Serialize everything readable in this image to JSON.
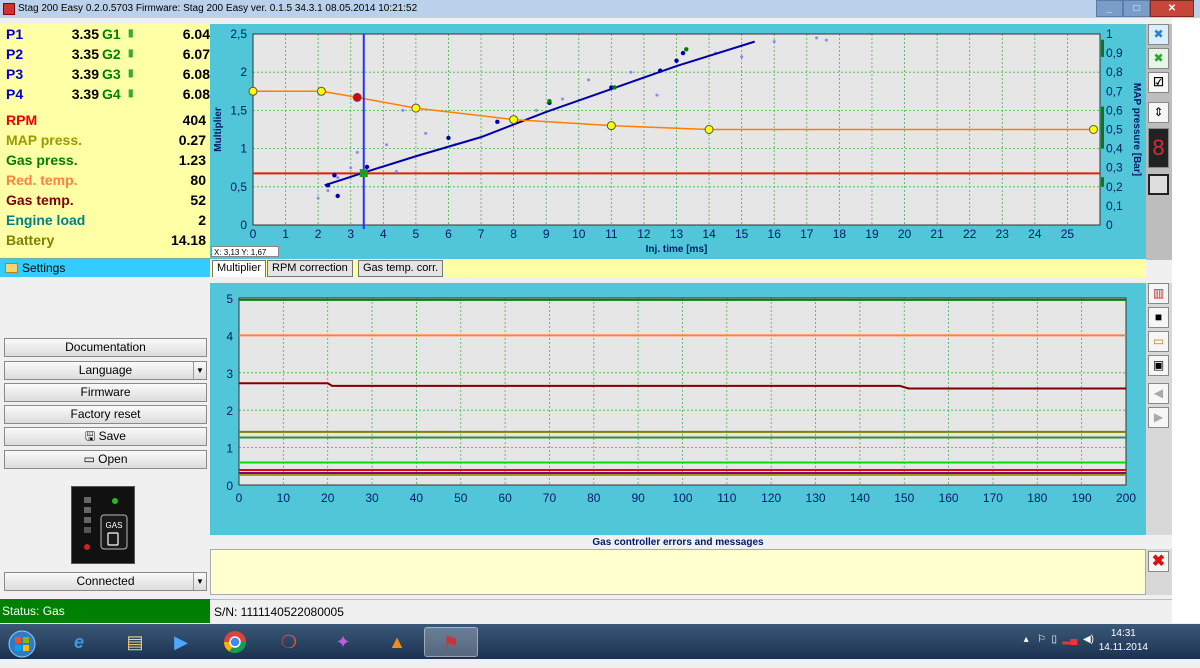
{
  "window": {
    "title": "Stag 200 Easy 0.2.0.5703 Firmware: Stag 200 Easy  ver. 0.1.5  34.3.1   08.05.2014 10:21:52"
  },
  "injectors": [
    {
      "p_label": "P1",
      "p_value": "3.35",
      "g_label": "G1",
      "g_value": "6.04"
    },
    {
      "p_label": "P2",
      "p_value": "3.35",
      "g_label": "G2",
      "g_value": "6.07"
    },
    {
      "p_label": "P3",
      "p_value": "3.39",
      "g_label": "G3",
      "g_value": "6.08"
    },
    {
      "p_label": "P4",
      "p_value": "3.39",
      "g_label": "G4",
      "g_value": "6.08"
    }
  ],
  "sensors": [
    {
      "label": "RPM",
      "value": "404",
      "color": "#ee0000"
    },
    {
      "label": "MAP press.",
      "value": "0.27",
      "color": "#999900"
    },
    {
      "label": "Gas press.",
      "value": "1.23",
      "color": "#008000"
    },
    {
      "label": "Red. temp.",
      "value": "80",
      "color": "#ff8040"
    },
    {
      "label": "Gas temp.",
      "value": "52",
      "color": "#800000"
    },
    {
      "label": "Engine load",
      "value": "2",
      "color": "#008080"
    },
    {
      "label": "Battery",
      "value": "14.18",
      "color": "#808000"
    }
  ],
  "settings_label": "Settings",
  "buttons": {
    "documentation": "Documentation",
    "language": "Language",
    "firmware": "Firmware",
    "factory_reset": "Factory reset",
    "save": "Save",
    "open": "Open",
    "connected": "Connected"
  },
  "gas_switch_label": "GAS",
  "status": "Status: Gas",
  "serial": "S/N: 1111140522080005",
  "coord_readout": "X: 3,13  Y: 1,67",
  "tabs": [
    "Multiplier",
    "RPM correction",
    "Gas temp. corr."
  ],
  "messages_title": "Gas controller errors and messages",
  "clock": {
    "time": "14:31",
    "date": "14.11.2014"
  },
  "chart_data": [
    {
      "type": "line",
      "xlabel": "Inj. time [ms]",
      "ylabel": "Multiplier",
      "y2label": "MAP pressure [Bar]",
      "xlim": [
        0,
        26
      ],
      "ylim": [
        0,
        2.5
      ],
      "y2lim": [
        0,
        1.0
      ],
      "xticks": [
        0,
        1,
        2,
        3,
        4,
        5,
        6,
        7,
        8,
        9,
        10,
        11,
        12,
        13,
        14,
        15,
        16,
        17,
        18,
        19,
        20,
        21,
        22,
        23,
        24,
        25
      ],
      "yticks": [
        "0",
        "0,5",
        "1",
        "1,5",
        "2",
        "2,5"
      ],
      "y2ticks": [
        "0",
        "0,1",
        "0,2",
        "0,3",
        "0,4",
        "0,5",
        "0,6",
        "0,7",
        "0,8",
        "0,9",
        "1"
      ],
      "cursor_x": 3.4,
      "map_level": 0.27,
      "series": [
        {
          "color": "#ff8000",
          "x": [
            0,
            2.1,
            3.2,
            5.0,
            8.0,
            11.0,
            14.0,
            25.8
          ],
          "y": [
            1.75,
            1.75,
            1.67,
            1.53,
            1.38,
            1.3,
            1.25,
            1.25
          ]
        },
        {
          "color": "#0000aa",
          "x": [
            2.2,
            3.5,
            5.0,
            7.0,
            9.0,
            11.0,
            13.0,
            15.4
          ],
          "y": [
            0.52,
            0.7,
            0.9,
            1.15,
            1.48,
            1.78,
            2.08,
            2.4
          ]
        }
      ]
    },
    {
      "type": "line",
      "xlim": [
        0,
        200
      ],
      "ylim": [
        0,
        5
      ],
      "xticks": [
        0,
        10,
        20,
        30,
        40,
        50,
        60,
        70,
        80,
        90,
        100,
        110,
        120,
        130,
        140,
        150,
        160,
        170,
        180,
        190,
        200
      ],
      "yticks": [
        0,
        1,
        2,
        3,
        4,
        5
      ],
      "series": [
        {
          "color": "#008000",
          "x": [
            0,
            200
          ],
          "y": [
            4.95,
            4.95
          ]
        },
        {
          "color": "#ff8040",
          "x": [
            0,
            200
          ],
          "y": [
            4.0,
            4.0
          ]
        },
        {
          "color": "#800000",
          "x": [
            0,
            20,
            21,
            149,
            151,
            200
          ],
          "y": [
            2.72,
            2.72,
            2.65,
            2.65,
            2.58,
            2.58
          ]
        },
        {
          "color": "#808000",
          "x": [
            0,
            200
          ],
          "y": [
            1.42,
            1.42
          ]
        },
        {
          "color": "#3a8a3a",
          "x": [
            0,
            200
          ],
          "y": [
            1.27,
            1.27
          ]
        },
        {
          "color": "#00dd00",
          "x": [
            0,
            200
          ],
          "y": [
            0.6,
            0.6
          ]
        },
        {
          "color": "#ee0000",
          "x": [
            0,
            200
          ],
          "y": [
            0.4,
            0.4
          ]
        },
        {
          "color": "#999900",
          "x": [
            0,
            200
          ],
          "y": [
            0.27,
            0.27
          ]
        },
        {
          "color": "#800080",
          "x": [
            0,
            200
          ],
          "y": [
            0.32,
            0.32
          ]
        }
      ]
    }
  ]
}
